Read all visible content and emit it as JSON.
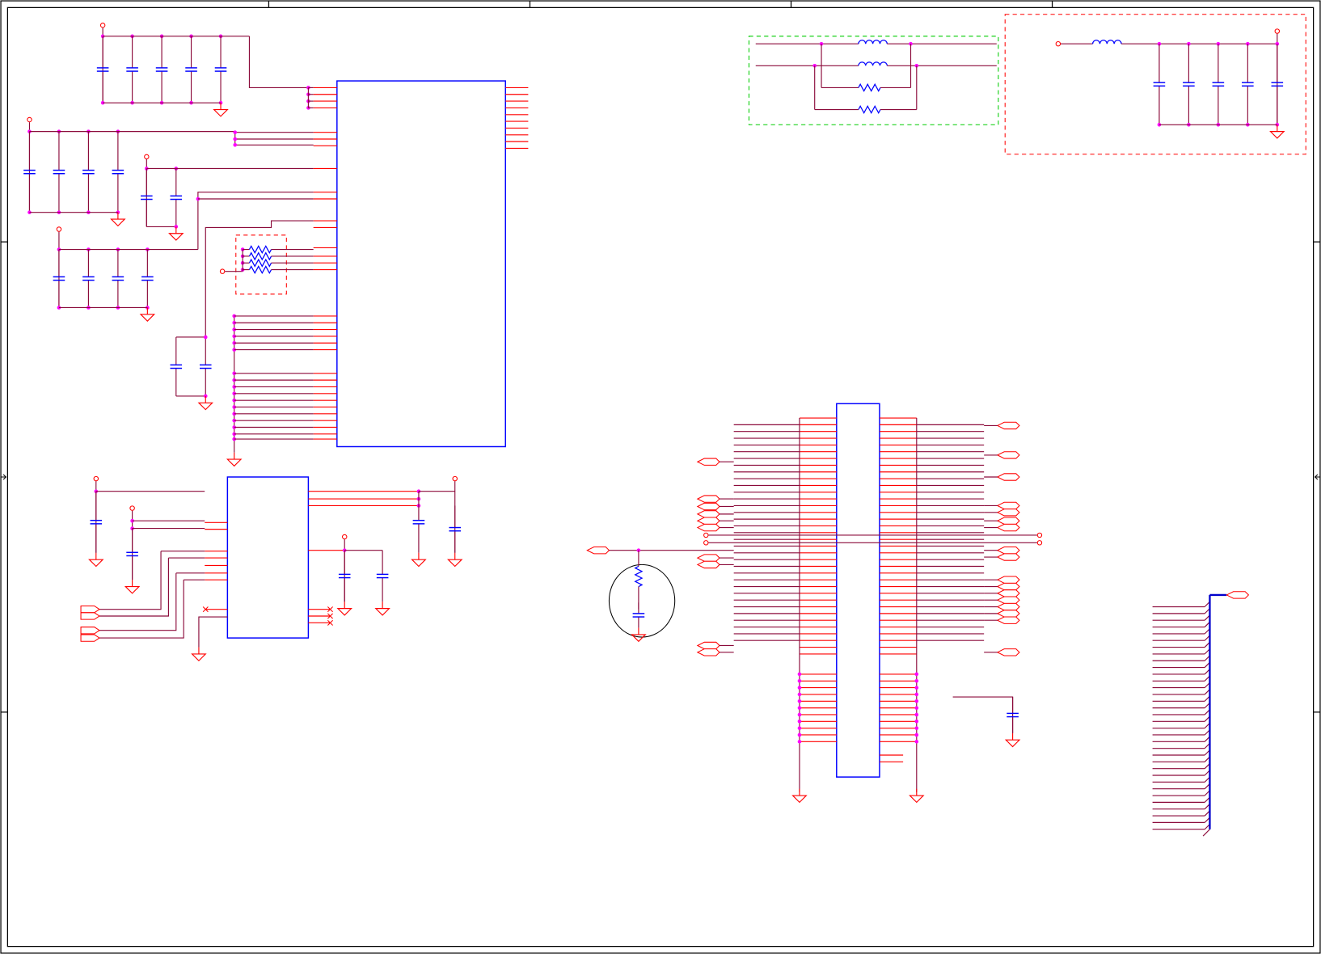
{
  "diagram": {
    "kind": "electronic schematic sheet",
    "colors": {
      "wire": "#8b0a3a",
      "pin": "#ff0000",
      "component": "#0000ff",
      "junction": "#ff00ff",
      "frame": "#000000",
      "filter_box": "#00cc00"
    },
    "blocks": [
      {
        "name": "main-ic",
        "type": "integrated-circuit"
      },
      {
        "name": "buffer-ic",
        "type": "integrated-circuit"
      },
      {
        "name": "connector",
        "type": "connector"
      },
      {
        "name": "ferrite-filter",
        "type": "inductor-network"
      },
      {
        "name": "power-filter",
        "type": "lc-filter"
      },
      {
        "name": "rc-network",
        "type": "resistor-capacitor"
      },
      {
        "name": "signal-bus",
        "type": "bus"
      }
    ],
    "text_labels": []
  }
}
